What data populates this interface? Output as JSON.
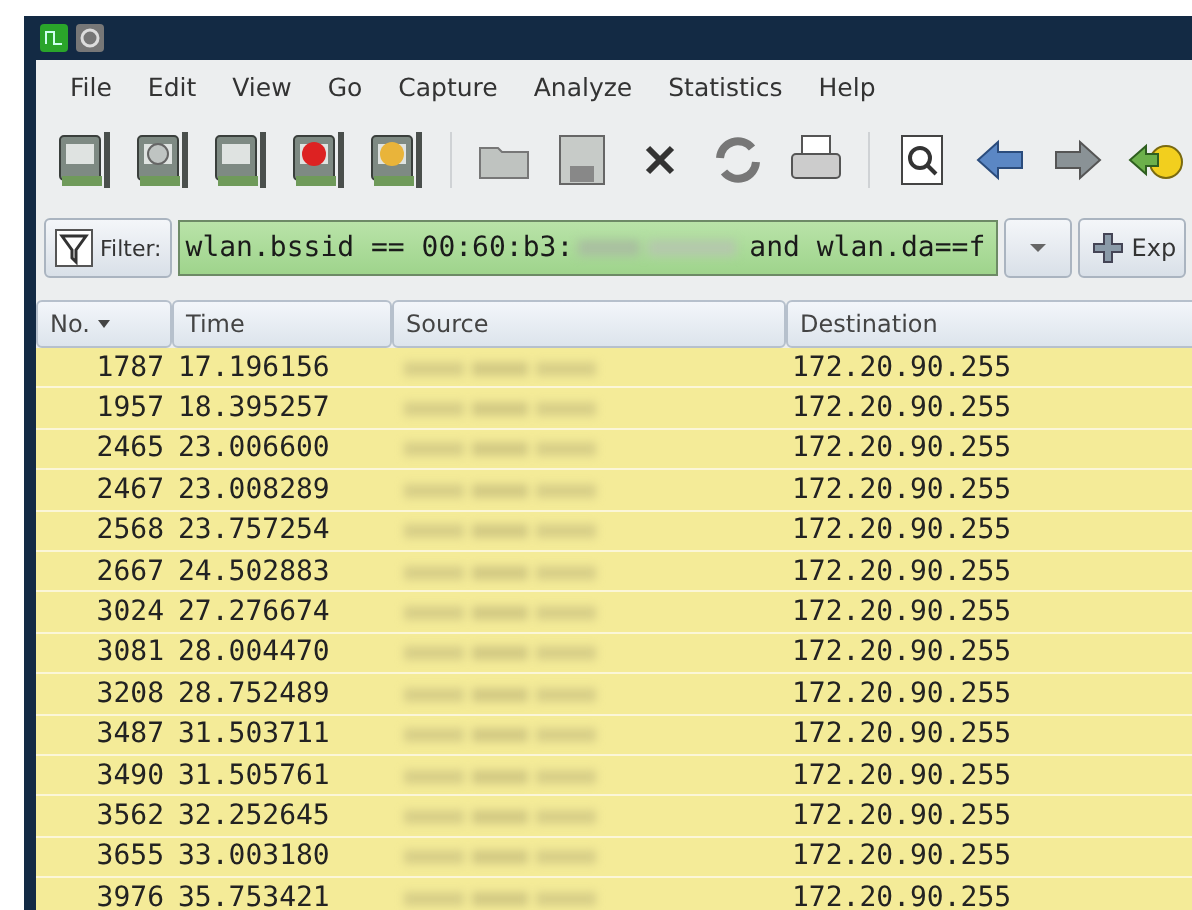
{
  "menu": [
    "File",
    "Edit",
    "View",
    "Go",
    "Capture",
    "Analyze",
    "Statistics",
    "Help"
  ],
  "filter": {
    "label": "Filter:",
    "value_start": "wlan.bssid == 00:60:b3:",
    "value_end": "and wlan.da==f",
    "expression_button": "Exp"
  },
  "table": {
    "columns": [
      "No.",
      "Time",
      "Source",
      "Destination"
    ],
    "rows": [
      {
        "no": "1787",
        "time": "17.196156",
        "destination": "172.20.90.255"
      },
      {
        "no": "1957",
        "time": "18.395257",
        "destination": "172.20.90.255"
      },
      {
        "no": "2465",
        "time": "23.006600",
        "destination": "172.20.90.255"
      },
      {
        "no": "2467",
        "time": "23.008289",
        "destination": "172.20.90.255"
      },
      {
        "no": "2568",
        "time": "23.757254",
        "destination": "172.20.90.255"
      },
      {
        "no": "2667",
        "time": "24.502883",
        "destination": "172.20.90.255"
      },
      {
        "no": "3024",
        "time": "27.276674",
        "destination": "172.20.90.255"
      },
      {
        "no": "3081",
        "time": "28.004470",
        "destination": "172.20.90.255"
      },
      {
        "no": "3208",
        "time": "28.752489",
        "destination": "172.20.90.255"
      },
      {
        "no": "3487",
        "time": "31.503711",
        "destination": "172.20.90.255"
      },
      {
        "no": "3490",
        "time": "31.505761",
        "destination": "172.20.90.255"
      },
      {
        "no": "3562",
        "time": "32.252645",
        "destination": "172.20.90.255"
      },
      {
        "no": "3655",
        "time": "33.003180",
        "destination": "172.20.90.255"
      },
      {
        "no": "3976",
        "time": "35.753421",
        "destination": "172.20.90.255"
      }
    ]
  }
}
